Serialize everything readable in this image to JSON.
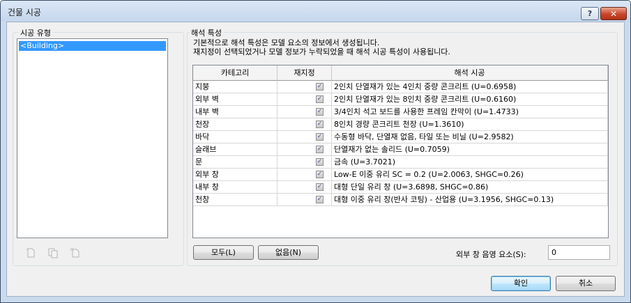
{
  "window": {
    "title": "건물 시공",
    "help_label": "?",
    "close_label": "✕"
  },
  "construction_types": {
    "label": "시공 유형",
    "items": [
      "<Building>"
    ],
    "icons": [
      "new-icon",
      "duplicate-icon",
      "delete-icon"
    ]
  },
  "analytic": {
    "label": "해석 특성",
    "description_line1": "기본적으로 해석 특성은 모델 요소의 정보에서 생성됩니다.",
    "description_line2": "재지정이 선택되었거나 모델 정보가 누락되었을 때 해석 시공 특성이 사용됩니다.",
    "columns": [
      "카테고리",
      "재지정",
      "해석 시공"
    ],
    "rows": [
      {
        "category": "지붕",
        "override": true,
        "construction": "2인치 단열재가 있는 4인치 중량 콘크리트 (U=0.6958)"
      },
      {
        "category": "외부 벽",
        "override": true,
        "construction": "2인치 단열재가 있는 8인치 중량 콘크리트 (U=0.6160)"
      },
      {
        "category": "내부 벽",
        "override": true,
        "construction": "3/4인치 석고 보드를 사용한 프레임 칸막이 (U=1.4733)"
      },
      {
        "category": "천장",
        "override": true,
        "construction": "8인치 경량 콘크리트 천장 (U=1.3610)"
      },
      {
        "category": "바닥",
        "override": true,
        "construction": "수동형 바닥, 단열재 없음, 타일 또는 비닐 (U=2.9582)"
      },
      {
        "category": "슬래브",
        "override": true,
        "construction": "단열재가 없는 솔리드 (U=0.7059)"
      },
      {
        "category": "문",
        "override": true,
        "construction": "금속 (U=3.7021)"
      },
      {
        "category": "외부 창",
        "override": true,
        "construction": "Low-E 이중 유리 SC = 0.2 (U=2.0063, SHGC=0.26)"
      },
      {
        "category": "내부 창",
        "override": true,
        "construction": "대형 단일 유리 창 (U=3.6898, SHGC=0.86)"
      },
      {
        "category": "천창",
        "override": true,
        "construction": "대형 이중 유리 창(반사 코팅) - 산업용 (U=3.1956, SHGC=0.13)"
      }
    ],
    "all_button": "모두(L)",
    "none_button": "없음(N)",
    "shading_label": "외부 창 음영 요소(S):",
    "shading_value": "0"
  },
  "footer": {
    "ok": "확인",
    "cancel": "취소"
  }
}
